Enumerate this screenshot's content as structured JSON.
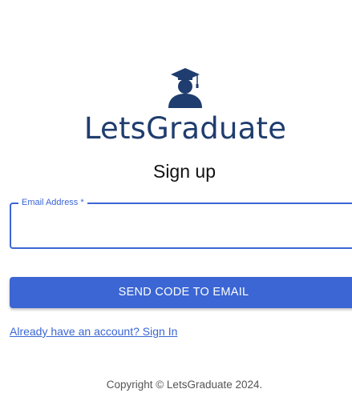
{
  "brand": {
    "name": "LetsGraduate",
    "logo_icon": "graduate-cap-icon",
    "color": "#1f3d6e"
  },
  "form": {
    "heading": "Sign up",
    "email_field": {
      "label": "Email Address *",
      "value": "",
      "accent_color": "#3b66d4"
    },
    "submit_label": "SEND CODE TO EMAIL",
    "signin_link": "Already have an account? Sign In"
  },
  "footer": {
    "copyright": "Copyright © LetsGraduate 2024."
  }
}
